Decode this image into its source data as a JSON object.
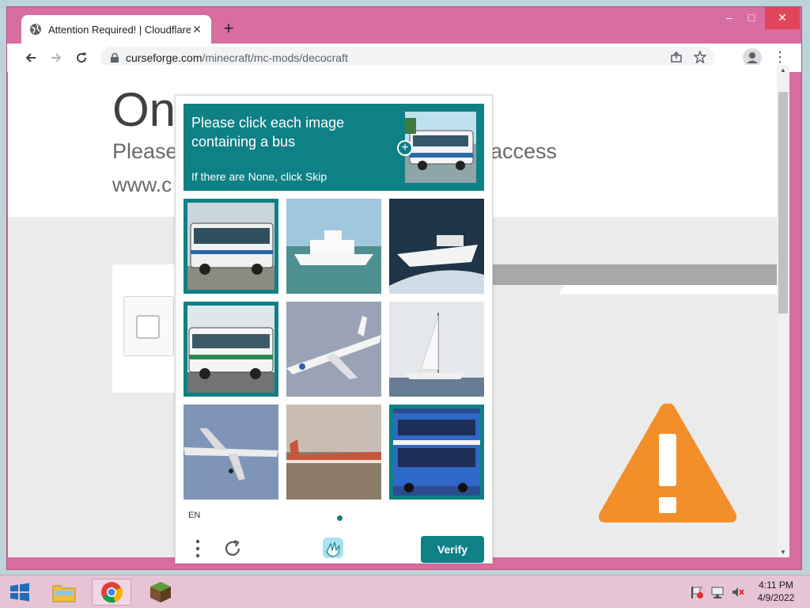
{
  "browser": {
    "tab_title": "Attention Required! | Cloudflare",
    "new_tab": "+",
    "url_host": "curseforge.com",
    "url_path": "/minecraft/mc-mods/decocraft",
    "window_controls": {
      "minimize": "–",
      "maximize": "□",
      "close": "✕"
    }
  },
  "page": {
    "heading": "On",
    "subtitle_start": "Please",
    "subtitle_end": "access",
    "site": "www.c"
  },
  "captcha": {
    "instruction": "Please click each image containing a bus",
    "skip_hint": "If there are None, click Skip",
    "tiles": [
      {
        "subject": "bus",
        "selected": true
      },
      {
        "subject": "ferry",
        "selected": false
      },
      {
        "subject": "speedboat",
        "selected": false
      },
      {
        "subject": "bus",
        "selected": true
      },
      {
        "subject": "airplane",
        "selected": false
      },
      {
        "subject": "sailboat",
        "selected": false
      },
      {
        "subject": "airplane",
        "selected": false
      },
      {
        "subject": "airplane",
        "selected": false
      },
      {
        "subject": "double-decker bus",
        "selected": true
      }
    ],
    "language": "EN",
    "verify_label": "Verify",
    "accent_color": "#0f8085"
  },
  "taskbar": {
    "time": "4:11 PM",
    "date": "4/9/2022"
  }
}
